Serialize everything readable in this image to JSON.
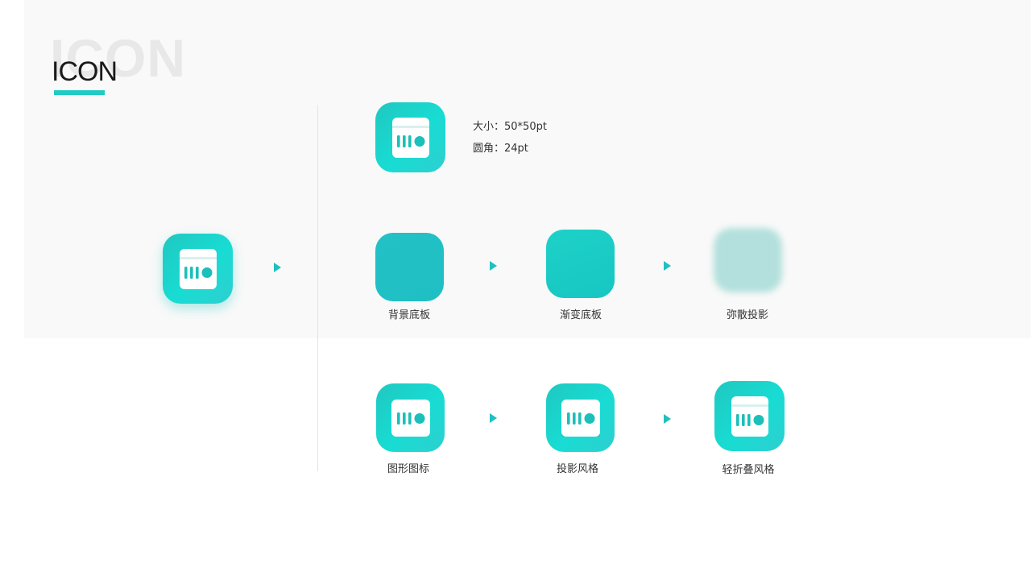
{
  "header": {
    "watermark": "ICON",
    "title": "ICON"
  },
  "specs": {
    "size_key": "大小：",
    "size_value": "50*50pt",
    "radius_key": "圆角：",
    "radius_value": "24pt"
  },
  "steps": {
    "bg_plate": "背景底板",
    "gradient_plate": "渐变底板",
    "diffuse_shadow": "弥散投影",
    "graphic_icon": "图形图标",
    "shadow_style": "投影风格",
    "light_fold_style": "轻折叠风格"
  },
  "colors": {
    "accent": "#1fcbc4",
    "gradient_start": "#1fc8c0",
    "gradient_end": "#18dcd3",
    "flat_plate": "#21c0c5",
    "blur_plate": "#b3e0dc",
    "arrow": "#1fc0c0"
  },
  "icons": [
    "radio-icon",
    "play-arrow-icon"
  ]
}
